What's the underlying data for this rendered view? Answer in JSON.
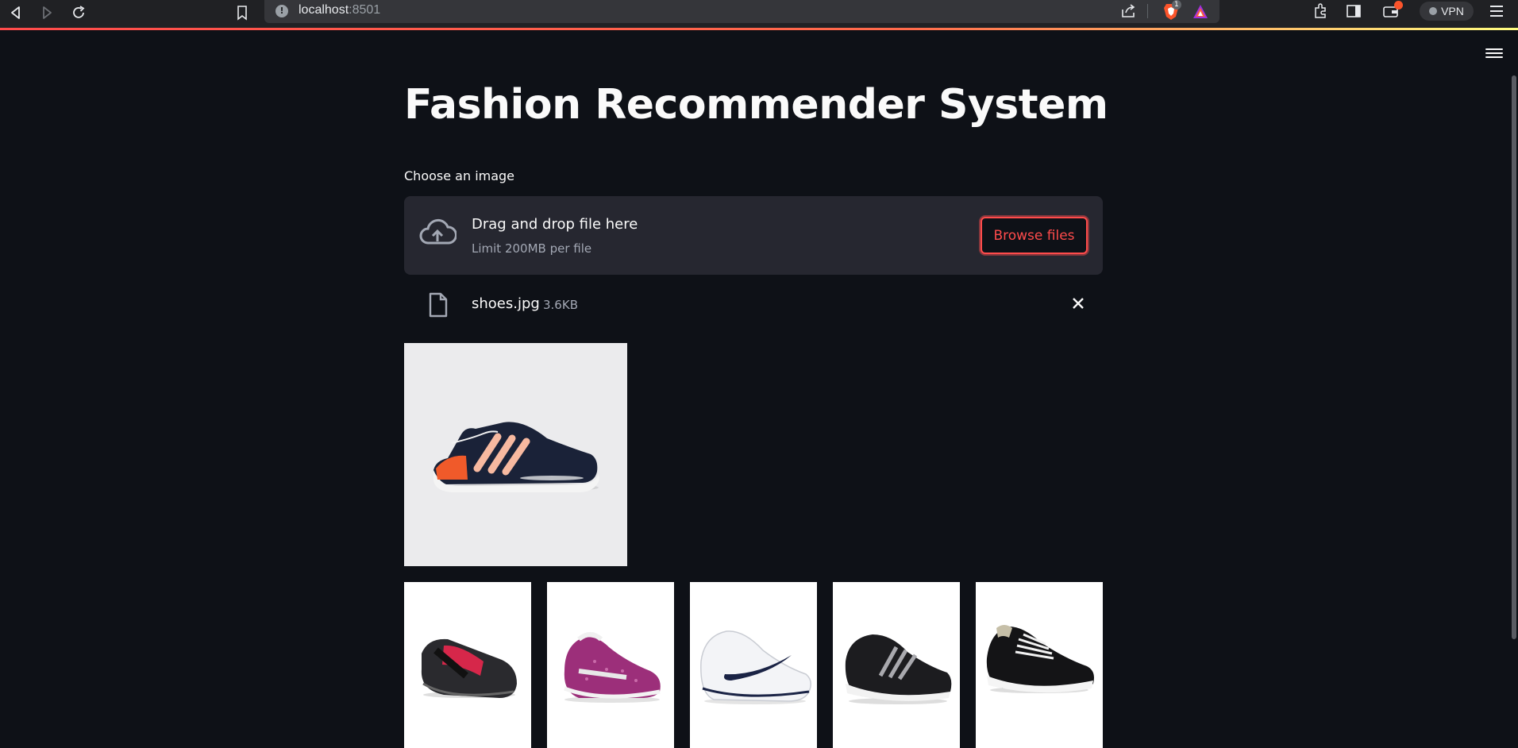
{
  "browser": {
    "url_host": "localhost",
    "url_port": ":8501",
    "brave_badge": "1",
    "vpn_label": "VPN"
  },
  "app": {
    "title": "Fashion Recommender System",
    "uploader": {
      "label": "Choose an image",
      "drop_title": "Drag and drop file here",
      "drop_limit": "Limit 200MB per file",
      "browse_label": "Browse files"
    },
    "file": {
      "name": "shoes.jpg",
      "size": "3.6KB"
    },
    "uploaded_image": {
      "icon": "navy-sneaker-image"
    },
    "recommendations": [
      {
        "icon": "black-red-mary-jane-shoe-image"
      },
      {
        "icon": "purple-knit-sneaker-image"
      },
      {
        "icon": "white-navy-swoosh-sneaker-image"
      },
      {
        "icon": "black-striped-running-shoe-image"
      },
      {
        "icon": "black-canvas-sneaker-image"
      }
    ]
  },
  "colors": {
    "background": "#0e1117",
    "panel": "#262730",
    "accent": "#ff4b4b",
    "muted_text": "#a3a8b4"
  }
}
